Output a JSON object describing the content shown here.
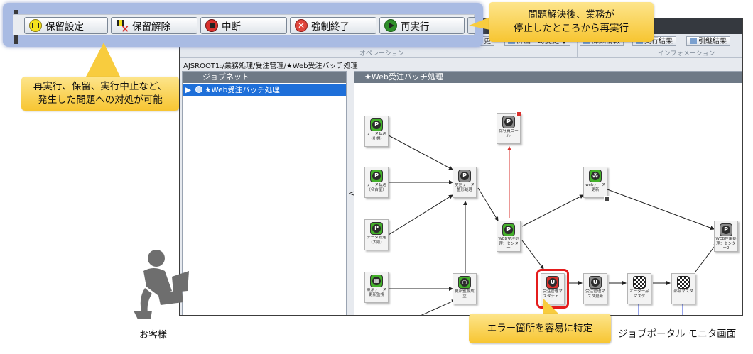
{
  "toolbar": {
    "hold_label": "保留設定",
    "release_label": "保留解除",
    "stop_label": "中断",
    "kill_label": "強制終了",
    "rerun_label": "再実行"
  },
  "ribbon": {
    "operation_group": "オペレーション",
    "information_group": "インフォメーション",
    "change_label": "更",
    "plan_change_label": "計画一時変更 ▼",
    "detail_label": "詳細情報",
    "exec_result_label": "実行結果",
    "succession_label": "引継結果"
  },
  "breadcrumb": "AJSROOT1:/業務処理/受注管理/★Web受注バッチ処理",
  "jobnet_panel": {
    "header": "ジョブネット",
    "selected_item": "★Web受注バッチ処理"
  },
  "collapse_glyph": "<",
  "flow_panel": {
    "header": "★Web受注バッチ処理",
    "nodes": [
      {
        "id": "n1",
        "icon": "P",
        "style": "green",
        "label": "データ転送（札幌）"
      },
      {
        "id": "n2",
        "icon": "P",
        "style": "green",
        "label": "データ転送（名古屋）"
      },
      {
        "id": "n3",
        "icon": "P",
        "style": "green",
        "label": "データ転送（大阪）"
      },
      {
        "id": "n4",
        "icon": "grid",
        "style": "green",
        "label": "東京データ更新監視"
      },
      {
        "id": "n5",
        "icon": "P",
        "style": "green",
        "label": "受信データ整形処理"
      },
      {
        "id": "n6",
        "icon": "○",
        "style": "green",
        "label": "更新監視成立"
      },
      {
        "id": "n7",
        "icon": "P",
        "style": "gray",
        "label": "保守員コール"
      },
      {
        "id": "n8",
        "icon": "P",
        "style": "green",
        "label": "WEB受注処理：センター"
      },
      {
        "id": "n9",
        "icon": "share",
        "style": "green",
        "label": "webデータ更新"
      },
      {
        "id": "n10",
        "icon": "U",
        "style": "red",
        "label": "受注管理マスタチェ..."
      },
      {
        "id": "n11",
        "icon": "U",
        "style": "gray",
        "label": "受注管理マスタ更新"
      },
      {
        "id": "n12",
        "icon": "flag",
        "style": "flag",
        "label": "オーダー品マスタ"
      },
      {
        "id": "n13",
        "icon": "flag",
        "style": "flag",
        "label": "部品マスタ"
      },
      {
        "id": "n14",
        "icon": "P",
        "style": "gray",
        "label": "WEB在庫処理：センター2"
      },
      {
        "id": "n15",
        "icon": "grid",
        "style": "gray",
        "label": ""
      }
    ]
  },
  "callouts": {
    "left": [
      "再実行、保留、実行中止など、",
      "発生した問題への対処が可能"
    ],
    "top": [
      "問題解決後、業務が",
      "停止したところから再実行"
    ],
    "bottom": "エラー箇所を容易に特定"
  },
  "labels": {
    "customer": "お客様",
    "monitor": "ジョブポータル モニタ画面"
  },
  "colors": {
    "callout": "#f7c531",
    "toolbar_frame": "#a9bbe3",
    "error_outline": "#e41c1c",
    "selection": "#1e6fd9",
    "panel_header": "#6e7986"
  }
}
